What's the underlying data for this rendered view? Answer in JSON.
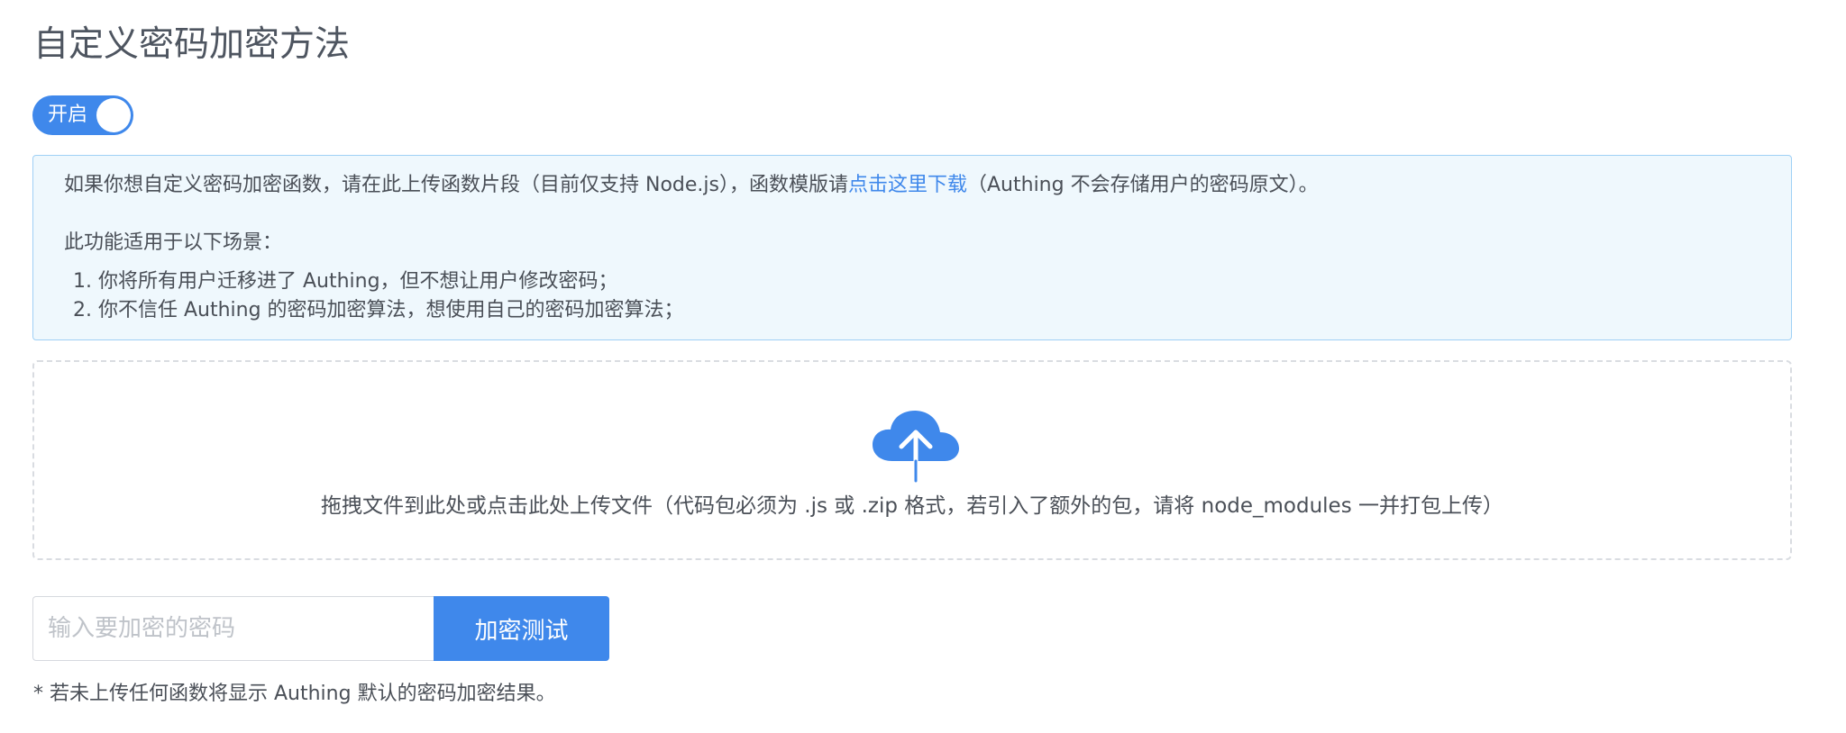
{
  "page": {
    "title": "自定义密码加密方法"
  },
  "toggle": {
    "label": "开启",
    "state": "on",
    "color": "#3f88eb"
  },
  "info": {
    "line1_before": "如果你想自定义密码加密函数，请在此上传函数片段（目前仅支持 Node.js），函数模版请",
    "line1_link": "点击这里下载",
    "line1_after": "（Authing 不会存储用户的密码原文）。",
    "line2": "此功能适用于以下场景：",
    "items": [
      "1. 你将所有用户迁移进了 Authing，但不想让用户修改密码；",
      "2. 你不信任 Authing 的密码加密算法，想使用自己的密码加密算法；"
    ],
    "background_color": "#eff8fd",
    "border_color": "#9fd0f5"
  },
  "upload": {
    "icon": "cloud-upload-icon",
    "text": "拖拽文件到此处或点击此处上传文件（代码包必须为 .js 或 .zip 格式，若引入了额外的包，请将 node_modules 一并打包上传）"
  },
  "encrypt_test": {
    "input_value": "",
    "input_placeholder": "输入要加密的密码",
    "button_label": "加密测试"
  },
  "footnote": "* 若未上传任何函数将显示 Authing 默认的密码加密结果。",
  "colors": {
    "accent": "#3f88eb",
    "text": "#4a4f57"
  }
}
